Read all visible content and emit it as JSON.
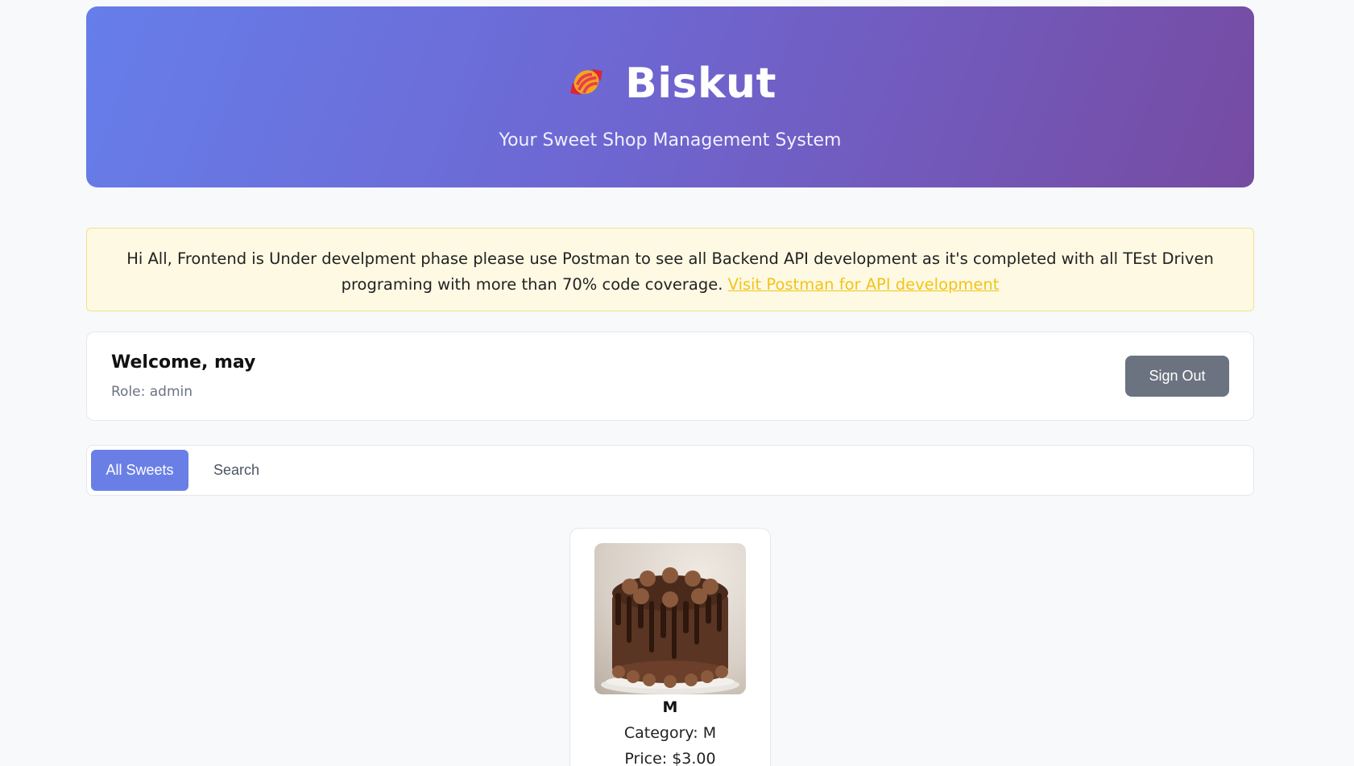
{
  "header": {
    "brand": "Biskut",
    "tagline": "Your Sweet Shop Management System"
  },
  "notice": {
    "text": "Hi All, Frontend is Under develpment phase please use Postman to see all Backend API development as it's completed with all TEst Driven programing with more than 70% code coverage.",
    "link_label": "Visit Postman for API development"
  },
  "welcome": {
    "greeting": "Welcome, may",
    "role": "Role: admin",
    "signout_label": "Sign Out"
  },
  "tabs": [
    {
      "label": "All Sweets",
      "active": true
    },
    {
      "label": "Search",
      "active": false
    }
  ],
  "products": [
    {
      "name": "M",
      "category": "Category: M",
      "price": "Price: $3.00",
      "image": "chocolate-cake-image"
    }
  ],
  "colors": {
    "header_gradient_start": "#667eea",
    "header_gradient_end": "#764ba2",
    "active_tab": "#6a7fe6",
    "signout_button": "#6b7280",
    "notice_link": "#f2c417"
  }
}
